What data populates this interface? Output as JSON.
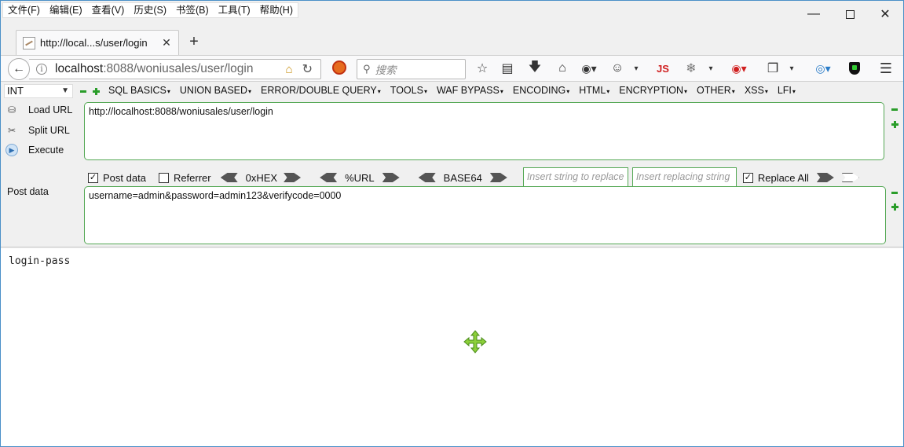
{
  "menu": [
    "文件(F)",
    "编辑(E)",
    "查看(V)",
    "历史(S)",
    "书签(B)",
    "工具(T)",
    "帮助(H)"
  ],
  "tab": {
    "title": "http://local...s/user/login"
  },
  "urlbar": {
    "host": "localhost",
    "rest": ":8088/woniusales/user/login"
  },
  "search": {
    "placeholder": "搜索"
  },
  "toolbar": {
    "js_label": "JS"
  },
  "hackbar": {
    "type_select": "INT",
    "menus": [
      "SQL BASICS",
      "UNION BASED",
      "ERROR/DOUBLE QUERY",
      "TOOLS",
      "WAF BYPASS",
      "ENCODING",
      "HTML",
      "ENCRYPTION",
      "OTHER",
      "XSS",
      "LFI"
    ],
    "load_url": "Load URL",
    "split_url": "Split URL",
    "execute": "Execute",
    "url_value": "http://localhost:8088/woniusales/user/login",
    "post_data_checkbox": "Post data",
    "referrer_checkbox": "Referrer",
    "hex_label": "0xHEX",
    "url_label": "%URL",
    "base64_label": "BASE64",
    "replace_placeholder": "Insert string to replace",
    "replacing_placeholder": "Insert replacing string",
    "replace_all": "Replace All",
    "post_data_label": "Post data",
    "post_data_value": "username=admin&password=admin123&verifycode=0000",
    "post_data_checked": true,
    "referrer_checked": false,
    "replace_all_checked": true
  },
  "page": {
    "body_text": "login-pass"
  }
}
